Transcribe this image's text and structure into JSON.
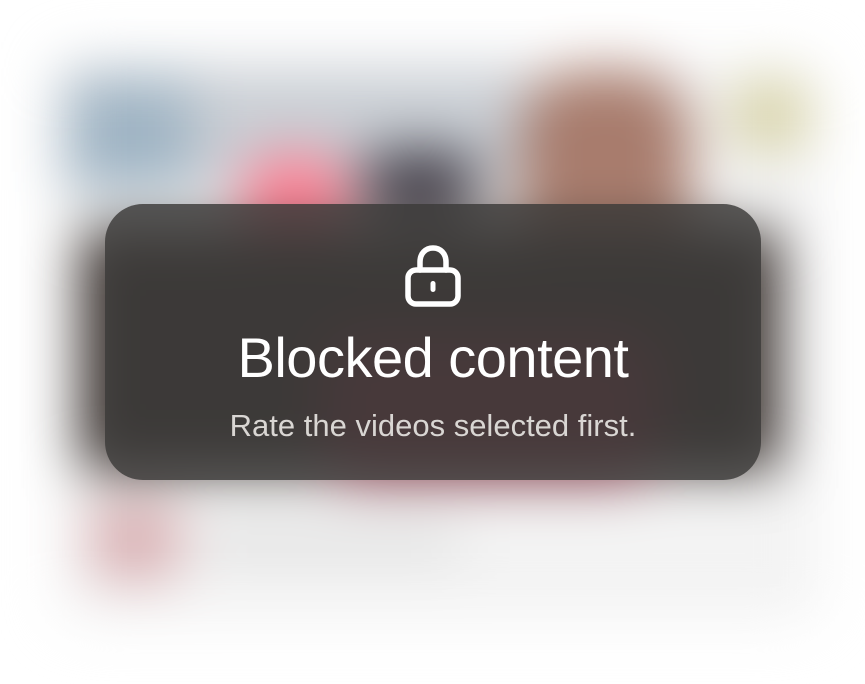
{
  "overlay": {
    "icon": "lock-icon",
    "title": "Blocked content",
    "subtitle": "Rate the videos selected first."
  },
  "colors": {
    "panel_background": "#3c3a39",
    "title_text": "#ffffff",
    "subtitle_text": "#d9d6d3"
  }
}
